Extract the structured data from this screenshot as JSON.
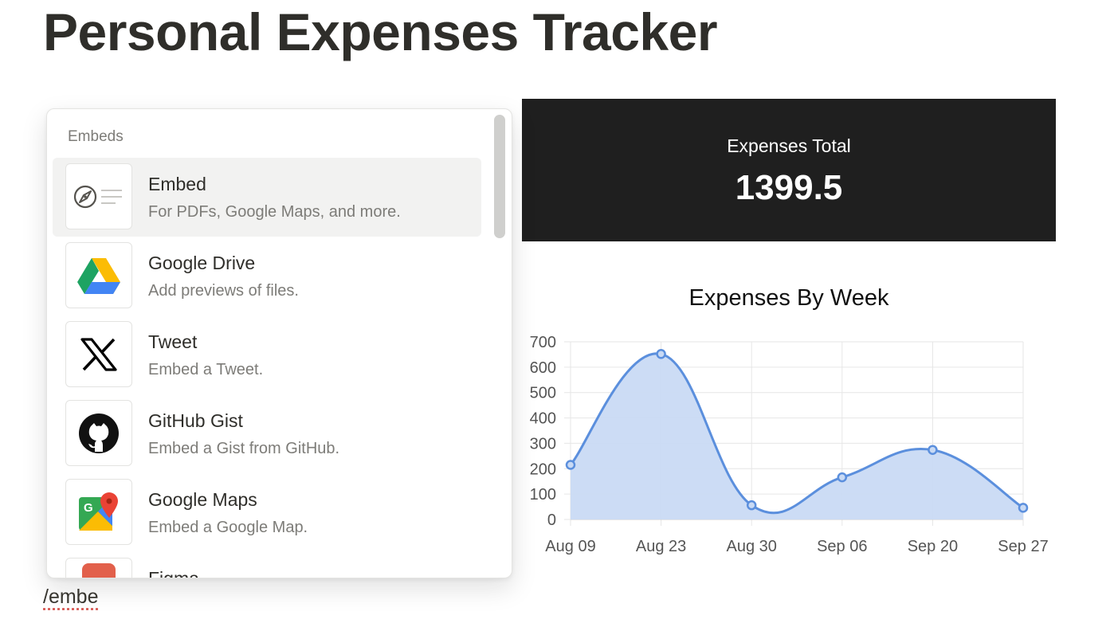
{
  "page": {
    "title": "Personal Expenses Tracker",
    "slash_command": "/embe"
  },
  "total_card": {
    "label": "Expenses Total",
    "value": "1399.5"
  },
  "embeds_menu": {
    "header": "Embeds",
    "items": [
      {
        "title": "Embed",
        "description": "For PDFs, Google Maps, and more.",
        "icon": "compass-embed-icon",
        "selected": true
      },
      {
        "title": "Google Drive",
        "description": "Add previews of files.",
        "icon": "google-drive-icon",
        "selected": false
      },
      {
        "title": "Tweet",
        "description": "Embed a Tweet.",
        "icon": "x-logo-icon",
        "selected": false
      },
      {
        "title": "GitHub Gist",
        "description": "Embed a Gist from GitHub.",
        "icon": "github-icon",
        "selected": false
      },
      {
        "title": "Google Maps",
        "description": "Embed a Google Map.",
        "icon": "google-maps-icon",
        "selected": false
      },
      {
        "title": "Figma",
        "description": "",
        "icon": "figma-icon",
        "selected": false
      }
    ]
  },
  "chart_data": {
    "type": "area",
    "title": "Expenses By Week",
    "categories": [
      "Aug 09",
      "Aug 23",
      "Aug 30",
      "Sep 06",
      "Sep 20",
      "Sep 27"
    ],
    "series": [
      {
        "values": [
          215,
          652,
          56,
          166,
          274,
          46
        ]
      }
    ],
    "ylim": [
      0,
      700
    ],
    "yticks": [
      0,
      100,
      200,
      300,
      400,
      500,
      600,
      700
    ],
    "grid": true,
    "colors": {
      "line": "#5b8fdd",
      "fill": "#c9daf4"
    }
  },
  "colors": {
    "card_bg": "#1f1f1f",
    "selected_row": "#f2f2f1"
  }
}
